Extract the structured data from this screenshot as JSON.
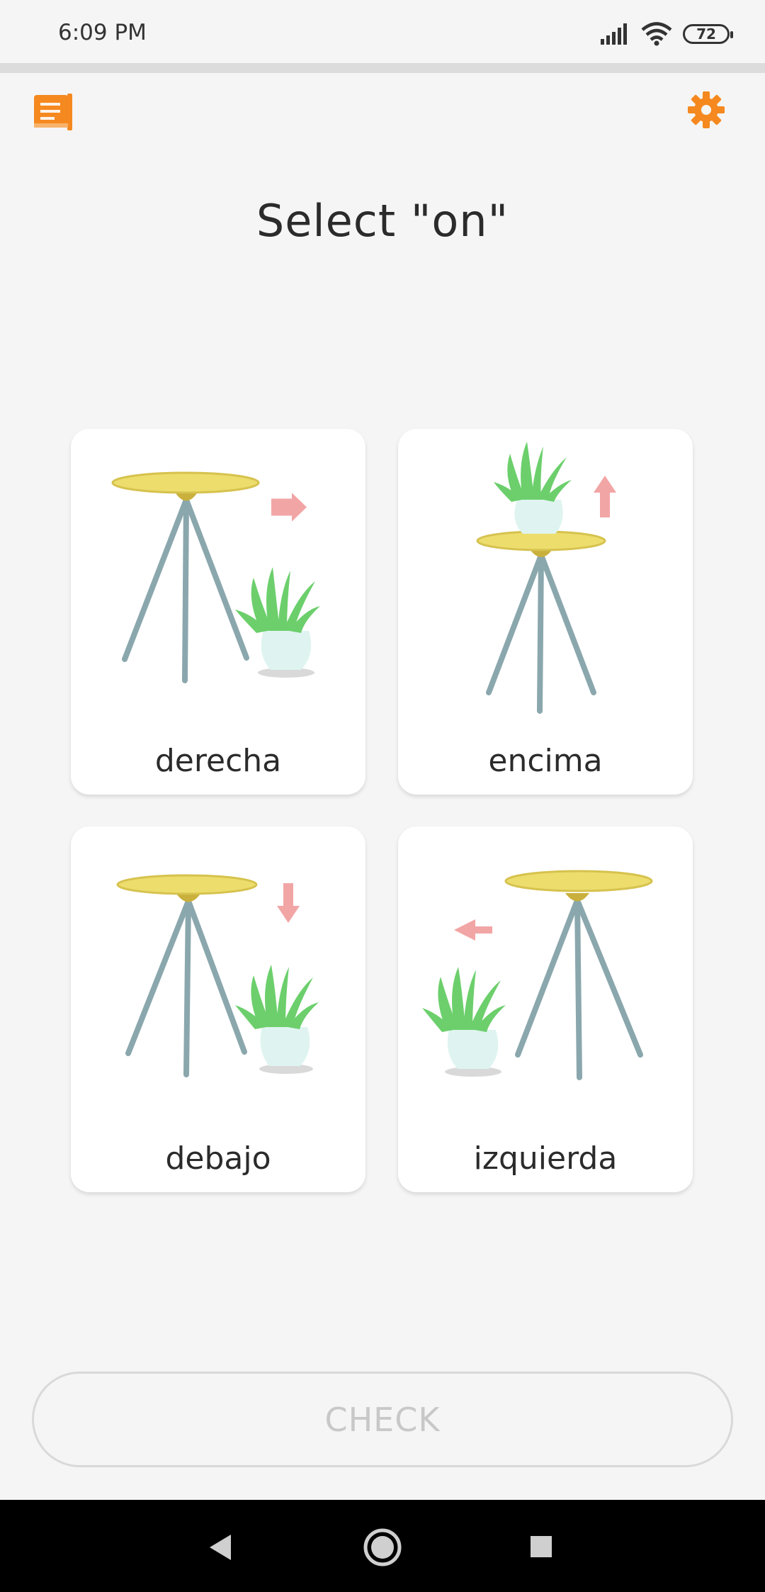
{
  "status_bar": {
    "time": "6:09 PM",
    "battery": "72",
    "icons": [
      "signal-icon",
      "wifi-icon",
      "battery-icon"
    ]
  },
  "toolbar": {
    "left_icon": "notebook-icon",
    "right_icon": "gear-icon",
    "accent_color": "#f5891f"
  },
  "prompt": "Select \"on\"",
  "options": [
    {
      "label": "derecha",
      "illustration": "plant-right-of-table"
    },
    {
      "label": "encima",
      "illustration": "plant-on-table"
    },
    {
      "label": "debajo",
      "illustration": "plant-below-table"
    },
    {
      "label": "izquierda",
      "illustration": "plant-left-of-table"
    }
  ],
  "check_label": "CHECK",
  "nav": {
    "back": "back-icon",
    "home": "home-icon",
    "recents": "recents-icon"
  }
}
